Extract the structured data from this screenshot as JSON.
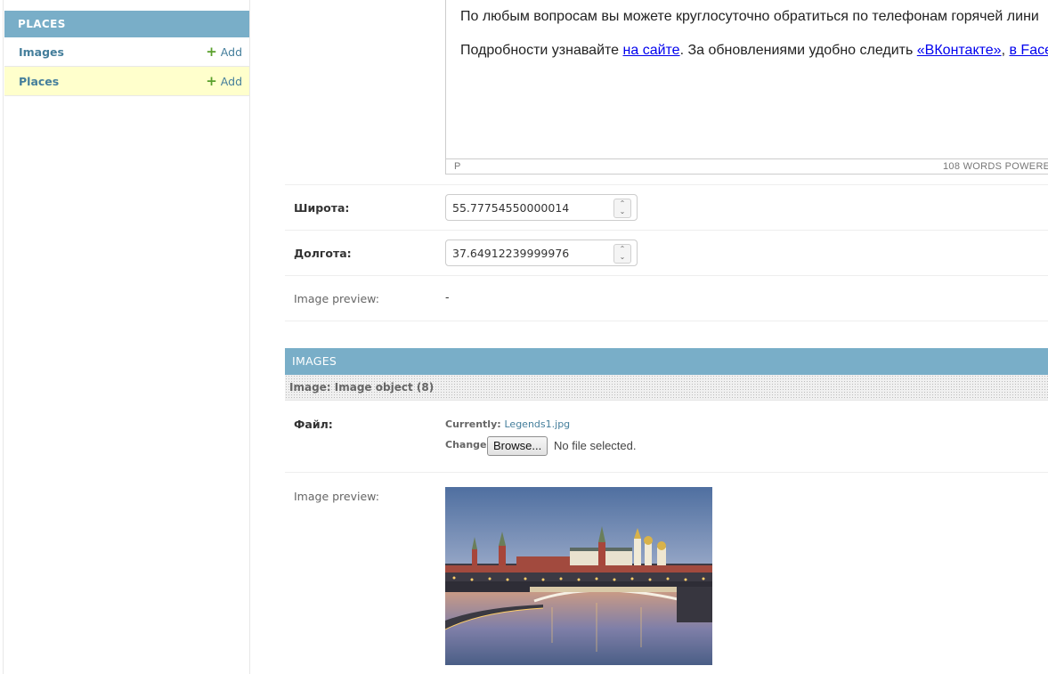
{
  "sidebar": {
    "module_caption": "PLACES",
    "models": [
      {
        "label": "Images",
        "add_label": "Add",
        "selected": false
      },
      {
        "label": "Places",
        "add_label": "Add",
        "selected": true
      }
    ]
  },
  "editor": {
    "line1": "По любым вопросам вы можете круглосуточно обратиться по телефонам горячей лини",
    "line2": {
      "before": "Подробности узнавайте ",
      "link1": "на сайте",
      "middle": ". За обновлениями удобно следить ",
      "link2": "«ВКонтакте»",
      "sep": ", ",
      "link3": "в Face"
    },
    "status_path": "P",
    "status_words": "108 WORDS  POWERED"
  },
  "fields": {
    "latitude": {
      "label": "Широта:",
      "value": "55.77754550000014"
    },
    "longitude": {
      "label": "Долгота:",
      "value": "37.64912239999976"
    },
    "image_preview": {
      "label": "Image preview:",
      "value": "-"
    }
  },
  "inline": {
    "header": "IMAGES",
    "object_title": "Image: Image object (8)",
    "file_label": "Файл:",
    "currently_label": "Currently:",
    "current_file": "Legends1.jpg",
    "change_label": "Change:",
    "browse_label": "Browse...",
    "no_file_text": "No file selected.",
    "preview_label": "Image preview:"
  },
  "colors": {
    "caption_bg": "#79aec8",
    "link": "#447e9b",
    "add_plus": "#5aa02c",
    "selected_row": "#ffffcc"
  },
  "icons": [
    "plus-icon",
    "spinner-icon"
  ]
}
